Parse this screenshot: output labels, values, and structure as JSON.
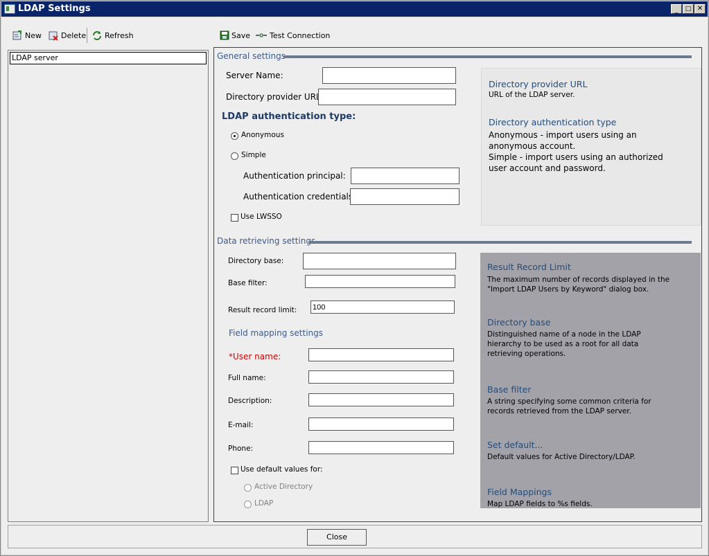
{
  "window": {
    "title": "LDAP Settings"
  },
  "left_toolbar": {
    "new_label": "New",
    "delete_label": "Delete",
    "refresh_label": "Refresh"
  },
  "right_toolbar": {
    "save_label": "Save",
    "test_connection_label": "Test Connection"
  },
  "server_list": {
    "items": [
      "LDAP server"
    ]
  },
  "general": {
    "section_title": "General settings",
    "server_name_label": "Server Name:",
    "server_name_value": "",
    "provider_url_label": "Directory provider URL:",
    "provider_url_value": "",
    "auth_type_heading": "LDAP authentication type:",
    "anonymous_label": "Anonymous",
    "simple_label": "Simple",
    "selected_auth": "Anonymous",
    "principal_label": "Authentication principal:",
    "principal_value": "",
    "credentials_label": "Authentication credentials:",
    "credentials_value": "",
    "lwsso_label": "Use LWSSO",
    "lwsso_checked": false
  },
  "general_help": {
    "url_title": "Directory provider URL",
    "url_text": "URL of the LDAP server.",
    "auth_title": "Directory authentication type",
    "auth_text1": "Anonymous - import users using an anonymous account.",
    "auth_text2": "Simple - import users using an authorized user account and password."
  },
  "retrieving": {
    "section_title": "Data retrieving settings",
    "directory_base_label": "Directory base:",
    "directory_base_value": "",
    "base_filter_label": "Base filter:",
    "base_filter_value": "",
    "record_limit_label": "Result record limit:",
    "record_limit_value": "100",
    "field_mapping_heading": "Field mapping settings",
    "user_name_label": "*User name:",
    "full_name_label": "Full name:",
    "description_label": "Description:",
    "email_label": "E-mail:",
    "phone_label": "Phone:",
    "use_defaults_label": "Use default values for:",
    "use_defaults_checked": false,
    "active_directory_label": "Active Directory",
    "ldap_label": "LDAP"
  },
  "retrieving_help": {
    "limit_title": "Result Record Limit",
    "limit_text": "The maximum number of records displayed in the \"Import LDAP Users by Keyword\" dialog box.",
    "base_title": "Directory base",
    "base_text": "Distinguished name of a node in the LDAP hierarchy to be used as a root for all data retrieving operations.",
    "filter_title": "Base filter",
    "filter_text": "A string specifying some common criteria for records retrieved from the LDAP server.",
    "default_title": "Set default...",
    "default_text": "Default values for Active Directory/LDAP.",
    "mappings_title": "Field Mappings",
    "mappings_text": "Map LDAP fields to %s fields."
  },
  "footer": {
    "close_label": "Close"
  },
  "colors": {
    "title_bar": "#0a246a",
    "section_title": "#3c5a8a",
    "help_title": "#234c7a",
    "required_label": "#cc0000",
    "help_panel_dark": "#a3a2a8"
  }
}
